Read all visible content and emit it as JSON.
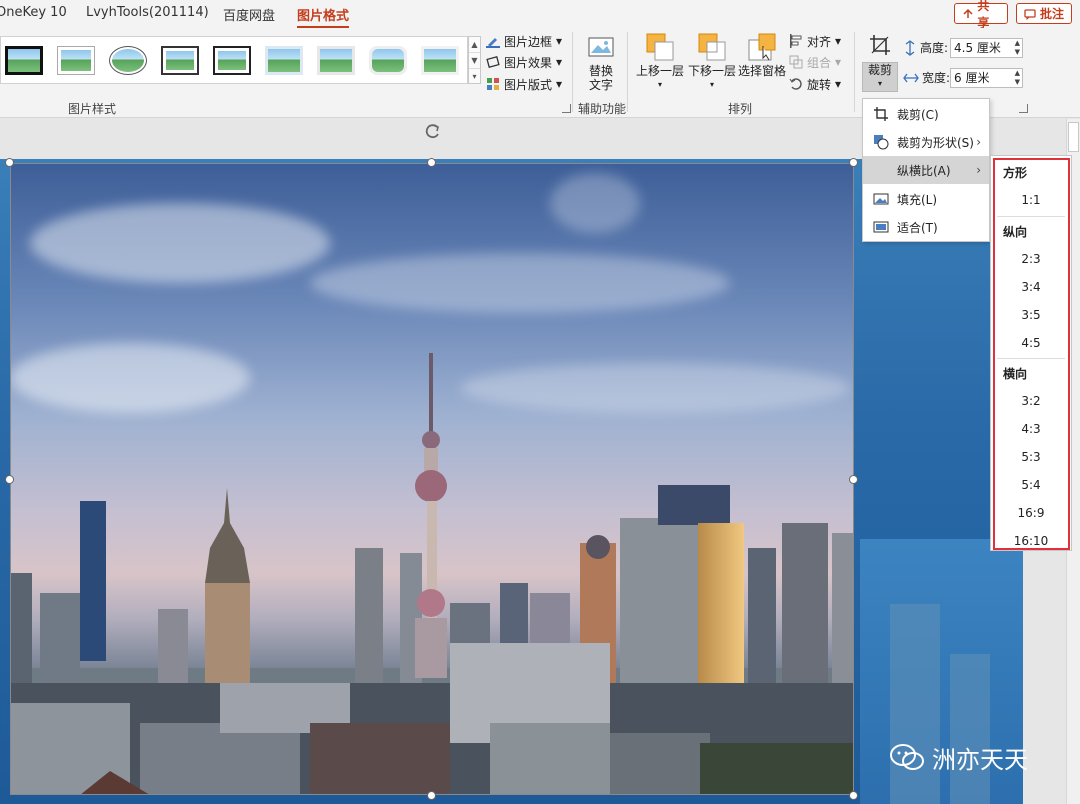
{
  "tabs": [
    {
      "label": "OneKey 10",
      "active": false
    },
    {
      "label": "LvyhTools(201114)",
      "active": false
    },
    {
      "label": "百度网盘",
      "active": false
    },
    {
      "label": "图片格式",
      "active": true
    }
  ],
  "header_buttons": {
    "share": "共享",
    "comment": "批注"
  },
  "ribbon": {
    "picture_styles": {
      "group_label": "图片样式",
      "border": "图片边框",
      "effects": "图片效果",
      "layout": "图片版式"
    },
    "accessibility": {
      "group_label": "辅助功能",
      "alt_text_line1": "替换",
      "alt_text_line2": "文字"
    },
    "arrange": {
      "group_label": "排列",
      "bring_forward": "上移一层",
      "send_backward": "下移一层",
      "selection_pane": "选择窗格",
      "align": "对齐",
      "group": "组合",
      "rotate": "旋转"
    },
    "size": {
      "crop": "裁剪",
      "height_label": "高度:",
      "height_value": "4.5 厘米",
      "width_label": "宽度:",
      "width_value": "6 厘米"
    }
  },
  "crop_menu": {
    "items": [
      {
        "label": "裁剪(C)",
        "icon": "crop-icon"
      },
      {
        "label": "裁剪为形状(S)",
        "icon": "shape-crop-icon",
        "submenu": true
      },
      {
        "label": "纵横比(A)",
        "icon": "",
        "submenu": true,
        "hover": true
      },
      {
        "label": "填充(L)",
        "icon": "fill-icon"
      },
      {
        "label": "适合(T)",
        "icon": "fit-icon"
      }
    ]
  },
  "aspect_menu": {
    "square_title": "方形",
    "square": [
      "1:1"
    ],
    "portrait_title": "纵向",
    "portrait": [
      "2:3",
      "3:4",
      "3:5",
      "4:5"
    ],
    "landscape_title": "横向",
    "landscape": [
      "3:2",
      "4:3",
      "5:3",
      "5:4",
      "16:9",
      "16:10"
    ]
  },
  "watermark": "洲亦天天",
  "colors": {
    "accent": "#c43e1c",
    "highlight": "#e0303a"
  }
}
